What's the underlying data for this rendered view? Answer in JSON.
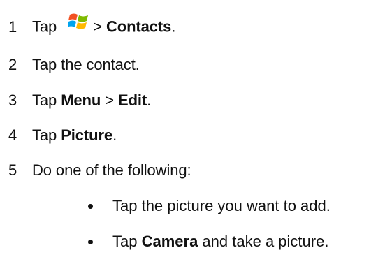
{
  "steps": [
    {
      "num": "1",
      "parts": [
        {
          "t": "Tap "
        },
        {
          "icon": "windows-start-icon"
        },
        {
          "t": "> "
        },
        {
          "t": "Contacts",
          "b": true
        },
        {
          "t": "."
        }
      ]
    },
    {
      "num": "2",
      "parts": [
        {
          "t": "Tap the contact."
        }
      ]
    },
    {
      "num": "3",
      "parts": [
        {
          "t": "Tap "
        },
        {
          "t": "Menu",
          "b": true
        },
        {
          "t": " > "
        },
        {
          "t": "Edit",
          "b": true
        },
        {
          "t": "."
        }
      ]
    },
    {
      "num": "4",
      "parts": [
        {
          "t": "Tap "
        },
        {
          "t": "Picture",
          "b": true
        },
        {
          "t": "."
        }
      ]
    },
    {
      "num": "5",
      "parts": [
        {
          "t": "Do one of the following:"
        }
      ]
    }
  ],
  "bullets": [
    {
      "parts": [
        {
          "t": "Tap the picture you want to add."
        }
      ]
    },
    {
      "parts": [
        {
          "t": "Tap "
        },
        {
          "t": "Camera",
          "b": true
        },
        {
          "t": " and take a picture."
        }
      ]
    }
  ],
  "colors": {
    "text": "#111111",
    "background": "#ffffff"
  }
}
